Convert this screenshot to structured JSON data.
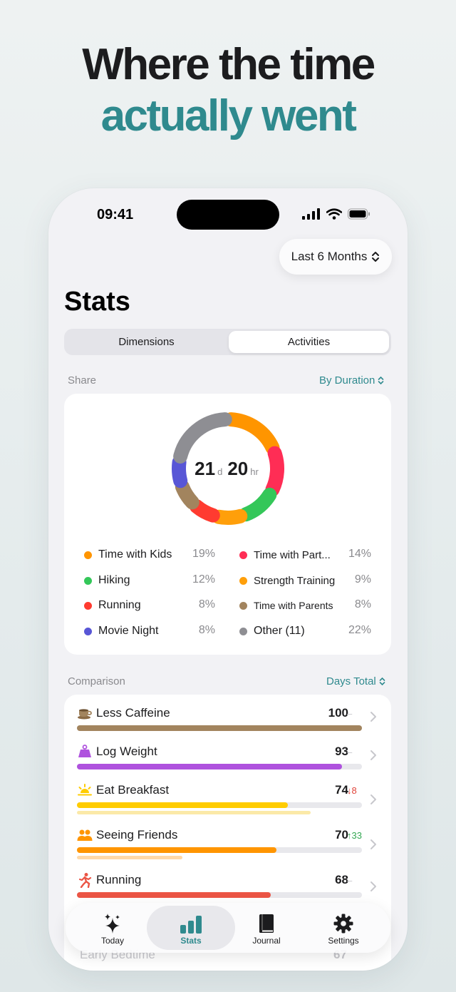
{
  "headline": {
    "line1": "Where the time",
    "line2": "actually went"
  },
  "status_bar": {
    "time": "09:41"
  },
  "range_selector": {
    "label": "Last 6 Months"
  },
  "page_title": "Stats",
  "tabs_segment": {
    "left": "Dimensions",
    "right": "Activities",
    "selected": "Activities"
  },
  "share": {
    "label": "Share",
    "sort_label": "By Duration",
    "total_days": "21",
    "days_unit": "d",
    "total_hours": "20",
    "hours_unit": "hr",
    "legend": [
      {
        "name": "Time with Kids",
        "pct": "19%",
        "color": "#ff9500"
      },
      {
        "name": "Time with Part...",
        "pct": "14%",
        "color": "#ff2d55"
      },
      {
        "name": "Hiking",
        "pct": "12%",
        "color": "#34c759"
      },
      {
        "name": "Strength Training",
        "pct": "9%",
        "color": "#ff9f0a"
      },
      {
        "name": "Running",
        "pct": "8%",
        "color": "#ff3b30"
      },
      {
        "name": "Time with Parents",
        "pct": "8%",
        "color": "#a2845e"
      },
      {
        "name": "Movie Night",
        "pct": "8%",
        "color": "#5856d6"
      },
      {
        "name": "Other (11)",
        "pct": "22%",
        "color": "#8e8e93"
      }
    ]
  },
  "comparison": {
    "label": "Comparison",
    "sort_label": "Days Total",
    "max": 100,
    "rows": [
      {
        "icon": "coffee-cup-icon",
        "name": "Less Caffeine",
        "value": "100",
        "delta": "–",
        "delta_dir": "none",
        "fraction": 1.0,
        "color": "#a2845e",
        "prev_fraction": 0
      },
      {
        "icon": "scale-weight-icon",
        "name": "Log Weight",
        "value": "93",
        "delta": "–",
        "delta_dir": "none",
        "fraction": 0.93,
        "color": "#af52de",
        "prev_fraction": 0
      },
      {
        "icon": "sunrise-icon",
        "name": "Eat Breakfast",
        "value": "74",
        "delta": "8",
        "delta_dir": "down",
        "fraction": 0.74,
        "color": "#ffcc00",
        "prev_fraction": 0.82
      },
      {
        "icon": "two-people-icon",
        "name": "Seeing Friends",
        "value": "70",
        "delta": "33",
        "delta_dir": "up",
        "fraction": 0.7,
        "color": "#ff9500",
        "prev_fraction": 0.37
      },
      {
        "icon": "running-figure-icon",
        "name": "Running",
        "value": "68",
        "delta": "–",
        "delta_dir": "none",
        "fraction": 0.68,
        "color": "#eb5545",
        "prev_fraction": 0
      }
    ],
    "partial_row": {
      "name": "Early Bedtime",
      "value": "67"
    }
  },
  "tab_bar": {
    "items": [
      {
        "label": "Today",
        "icon": "sparkles-icon"
      },
      {
        "label": "Stats",
        "icon": "bar-chart-icon",
        "active": true
      },
      {
        "label": "Journal",
        "icon": "book-icon"
      },
      {
        "label": "Settings",
        "icon": "gear-icon"
      }
    ]
  },
  "colors": {
    "accent": "#2f8a8e",
    "down": "#e0443a",
    "up": "#34a853"
  }
}
